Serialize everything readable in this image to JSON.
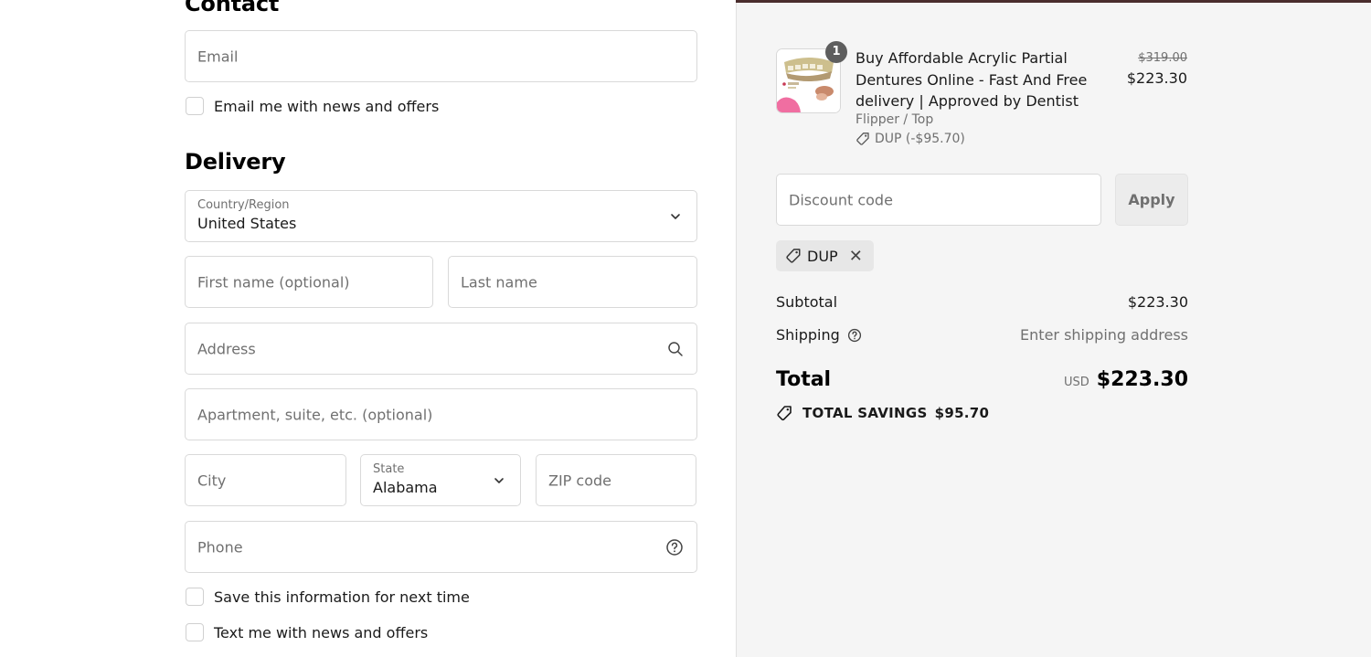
{
  "contact": {
    "title": "Contact",
    "email_placeholder": "Email",
    "news_checkbox_label": "Email me with news and offers"
  },
  "delivery": {
    "title": "Delivery",
    "country_label": "Country/Region",
    "country_value": "United States",
    "first_name_placeholder": "First name (optional)",
    "last_name_placeholder": "Last name",
    "address_placeholder": "Address",
    "apartment_placeholder": "Apartment, suite, etc. (optional)",
    "city_placeholder": "City",
    "state_label": "State",
    "state_value": "Alabama",
    "zip_placeholder": "ZIP code",
    "phone_placeholder": "Phone",
    "save_info_label": "Save this information for next time",
    "text_news_label": "Text me with news and offers"
  },
  "order": {
    "quantity": "1",
    "product_title": "Buy Affordable Acrylic Partial Dentures Online - Fast And Free delivery | Approved by Dentist",
    "variant": "Flipper / Top",
    "discount_applied": "DUP (-$95.70)",
    "original_price": "$319.00",
    "price": "$223.30"
  },
  "discount": {
    "placeholder": "Discount code",
    "apply_label": "Apply",
    "chip_code": "DUP",
    "remove_symbol": "✕"
  },
  "summary": {
    "subtotal_label": "Subtotal",
    "subtotal_value": "$223.30",
    "shipping_label": "Shipping",
    "shipping_value": "Enter shipping address",
    "total_label": "Total",
    "currency": "USD",
    "total_value": "$223.30",
    "savings_label": "TOTAL SAVINGS",
    "savings_value": "$95.70"
  },
  "colors": {
    "topbar": "#4a2d2d",
    "panel_bg": "#f5f5f5",
    "border": "#d9d9d9",
    "muted_text": "#707070"
  },
  "icons": [
    "chevron-down-icon",
    "search-icon",
    "help-circle-icon",
    "tag-icon",
    "close-icon"
  ]
}
